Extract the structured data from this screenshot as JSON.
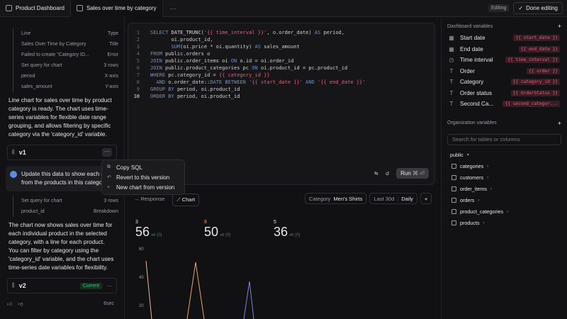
{
  "tabs": [
    {
      "label": "Product Dashboard"
    },
    {
      "label": "Sales over time by category"
    }
  ],
  "top": {
    "editing": "Editing",
    "done": "Done editing",
    "more": "···"
  },
  "left": {
    "table1": [
      {
        "k": "Line",
        "v": "Type"
      },
      {
        "k": "Sales Over Time by Category",
        "v": "Title"
      },
      {
        "k": "Failed to create \"Category ID...",
        "v": "Error"
      },
      {
        "k": "Set query for chart",
        "v": "3 rows"
      },
      {
        "k": "period",
        "v": "X-axis"
      },
      {
        "k": "sales_amount",
        "v": "Y-axis"
      }
    ],
    "msg1": "Line chart for sales over time by product category is ready. The chart uses time-series variables for flexible date range grouping, and allows filtering by specific category via the 'category_id' variable.",
    "v1": "v1",
    "user_msg": "Update this data to show each sa... from the products in this categor...",
    "table2": [
      {
        "k": "Set query for chart",
        "v": "3 rows"
      },
      {
        "k": "product_id",
        "v": "Breakdown"
      }
    ],
    "msg2": "The chart now shows sales over time for each individual product in the selected category, with a line for each product. You can filter by category using the 'category_id' variable, and the chart uses time-series date variables for flexibility.",
    "v2": "v2",
    "current": "Current",
    "time": "6sec"
  },
  "menu": {
    "copy": "Copy SQL",
    "revert": "Revert to this version",
    "new": "New chart from version"
  },
  "editor": {
    "run": "Run",
    "shortcut": "⌘ ⏎"
  },
  "results": {
    "tab_response": "Response",
    "tab_chart": "Chart",
    "category_label": "Category",
    "category_value": "Men's Shirts",
    "range": "Last 30d",
    "grain": "Daily"
  },
  "chart_data": {
    "type": "line",
    "kpis": [
      {
        "series": "3",
        "value": "56",
        "delta": "+0",
        "prev": "(0)"
      },
      {
        "series": "8",
        "value": "50",
        "delta": "+0",
        "prev": "(0)"
      },
      {
        "series": "5",
        "value": "36",
        "delta": "+0",
        "prev": "(0)"
      }
    ],
    "y_ticks": [
      "60",
      "40",
      "20"
    ],
    "ylim": [
      0,
      70
    ],
    "series": [
      {
        "name": "3",
        "color": "#e8b7a0"
      },
      {
        "name": "8",
        "color": "#e8a26a"
      },
      {
        "name": "5",
        "color": "#7b84e0"
      }
    ]
  },
  "right": {
    "dash_vars_title": "Dashboard variables",
    "vars": [
      {
        "name": "Start date",
        "token": "{{ start_date }}"
      },
      {
        "name": "End date",
        "token": "{{ end_date }}"
      },
      {
        "name": "Time interval",
        "token": "{{ time_interval }}"
      },
      {
        "name": "Order",
        "token": "{{ order }}"
      },
      {
        "name": "Category",
        "token": "{{ category_id }}"
      },
      {
        "name": "Order status",
        "token": "{{ OrderStatus }}"
      },
      {
        "name": "Second Ca...",
        "token": "{{ second_categor..."
      }
    ],
    "org_vars_title": "Organization variables",
    "search_placeholder": "Search for tables or columns",
    "schema": "public",
    "tables": [
      "categories",
      "customers",
      "order_items",
      "orders",
      "product_categories",
      "products"
    ]
  }
}
